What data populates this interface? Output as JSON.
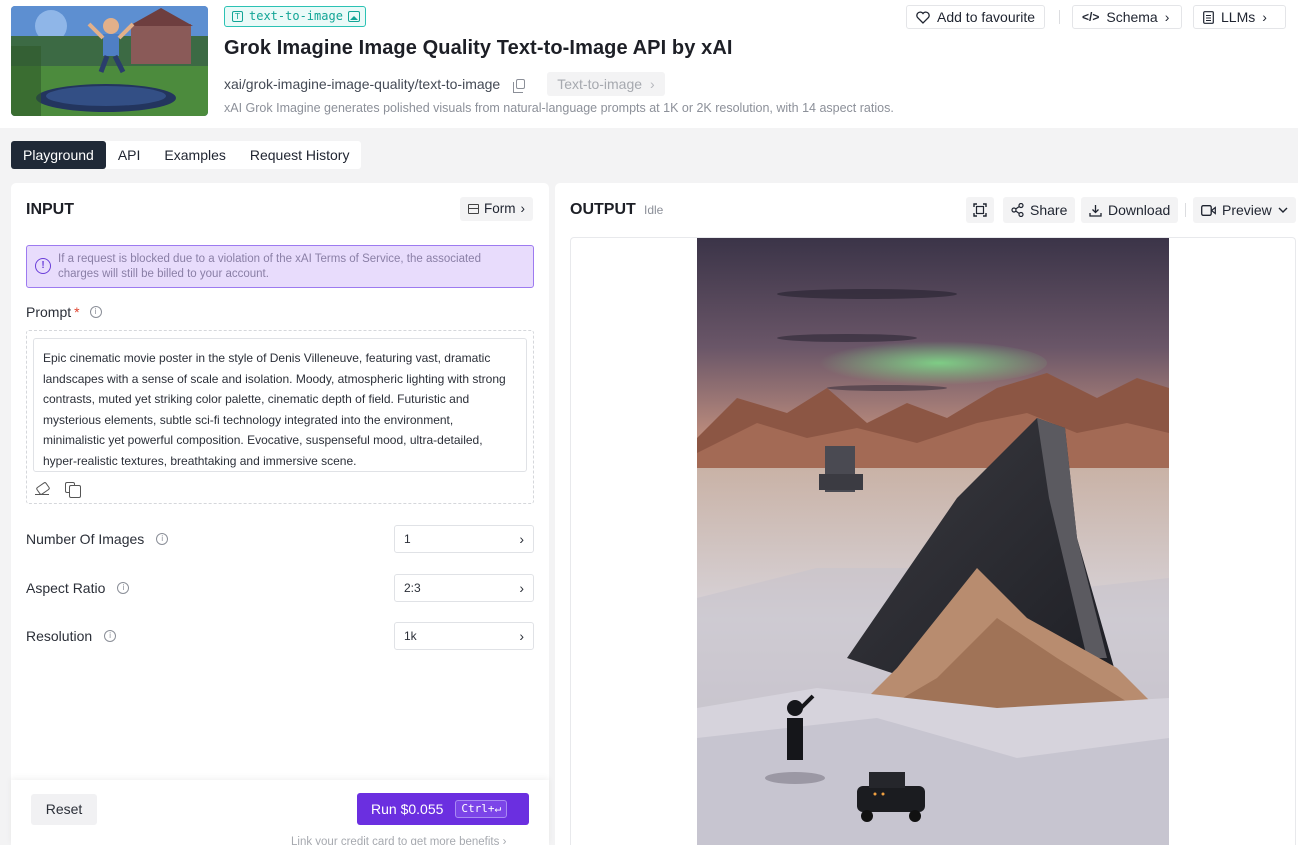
{
  "header": {
    "badge": "text-to-image",
    "title": "Grok Imagine Image Quality Text-to-Image API by xAI",
    "model_path": "xai/grok-imagine-image-quality/text-to-image",
    "category_chip": "Text-to-image",
    "description": "xAI Grok Imagine generates polished visuals from natural-language prompts at 1K or 2K resolution, with 14 aspect ratios.",
    "favourite_label": "Add to favourite",
    "schema_label": "Schema",
    "llms_label": "LLMs"
  },
  "tabs": [
    {
      "label": "Playground",
      "active": true
    },
    {
      "label": "API",
      "active": false
    },
    {
      "label": "Examples",
      "active": false
    },
    {
      "label": "Request History",
      "active": false
    }
  ],
  "input": {
    "title": "INPUT",
    "form_label": "Form",
    "notice": "If a request is blocked due to a violation of the xAI Terms of Service, the associated charges will still be billed to your account.",
    "prompt_label": "Prompt",
    "prompt_required": "*",
    "prompt_value": "Epic cinematic movie poster in the style of Denis Villeneuve, featuring vast, dramatic landscapes with a sense of scale and isolation. Moody, atmospheric lighting with strong contrasts, muted yet striking color palette, cinematic depth of field. Futuristic and mysterious elements, subtle sci-fi technology integrated into the environment, minimalistic yet powerful composition. Evocative, suspenseful mood, ultra-detailed, hyper-realistic textures, breathtaking and immersive scene.",
    "num_images_label": "Number Of Images",
    "num_images_value": "1",
    "aspect_label": "Aspect Ratio",
    "aspect_value": "2:3",
    "resolution_label": "Resolution",
    "resolution_value": "1k"
  },
  "footer": {
    "reset_label": "Reset",
    "run_label": "Run $0.055",
    "shortcut": "Ctrl+↵",
    "link_text": "Link your credit card to get more benefits"
  },
  "output": {
    "title": "OUTPUT",
    "status": "Idle",
    "share_label": "Share",
    "download_label": "Download",
    "preview_label": "Preview"
  },
  "colors": {
    "accent": "#6b2fe0",
    "badge": "#12a596",
    "notice_bg": "#e8dcfc",
    "tab_active": "#1f2937"
  }
}
